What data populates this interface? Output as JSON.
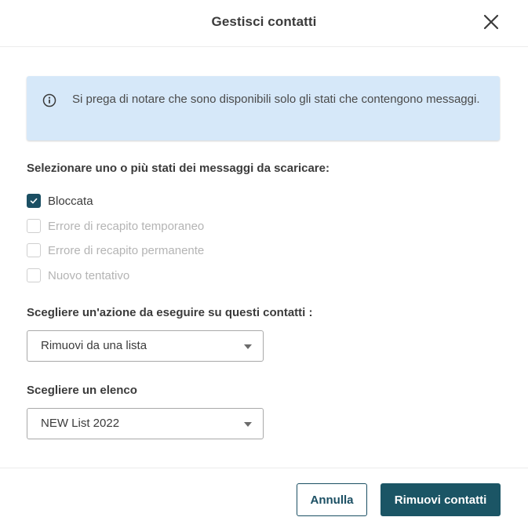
{
  "dialog": {
    "title": "Gestisci contatti",
    "close_icon": "close-icon"
  },
  "info": {
    "icon": "info-icon",
    "text": "Si prega di notare che sono disponibili solo gli stati che contengono messaggi."
  },
  "statuses": {
    "label": "Selezionare uno o più stati dei messaggi da scaricare:",
    "options": [
      {
        "label": "Bloccata",
        "checked": true,
        "enabled": true
      },
      {
        "label": "Errore di recapito temporaneo",
        "checked": false,
        "enabled": false
      },
      {
        "label": "Errore di recapito permanente",
        "checked": false,
        "enabled": false
      },
      {
        "label": "Nuovo tentativo",
        "checked": false,
        "enabled": false
      }
    ]
  },
  "action": {
    "label": "Scegliere un'azione da eseguire su questi contatti :",
    "selected": "Rimuovi da una lista"
  },
  "list": {
    "label": "Scegliere un elenco",
    "selected": "NEW List 2022"
  },
  "footer": {
    "cancel_label": "Annulla",
    "confirm_label": "Rimuovi contatti"
  },
  "colors": {
    "primary": "#1b5565",
    "info_background": "#d6e8f9",
    "disabled_text": "#b4b4b4"
  }
}
